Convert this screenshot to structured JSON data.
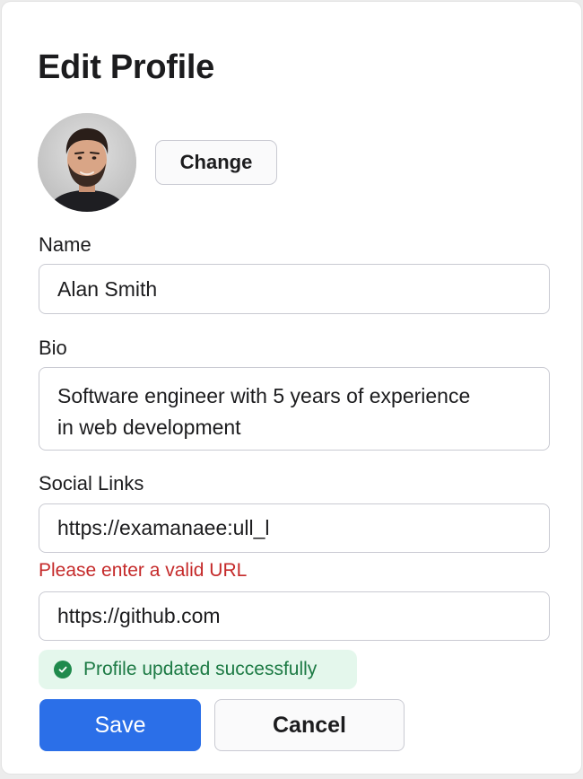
{
  "form": {
    "title": "Edit Profile",
    "avatar_icon": "user-photo",
    "change_label": "Change",
    "name": {
      "label": "Name",
      "value": "Alan Smith"
    },
    "bio": {
      "label": "Bio",
      "value": "Software engineer with 5 years of experience\nin web development"
    },
    "social": {
      "label": "Social Links",
      "link1": "https://examanaee:ull_l",
      "link1_error": "Please enter a valid URL",
      "link2": "https://github.com"
    },
    "toast": {
      "icon": "check-circle-icon",
      "text": "Profile updated successfully",
      "color": "#1f8a4c"
    },
    "buttons": {
      "save": "Save",
      "cancel": "Cancel",
      "save_color": "#2b6fe8"
    }
  }
}
